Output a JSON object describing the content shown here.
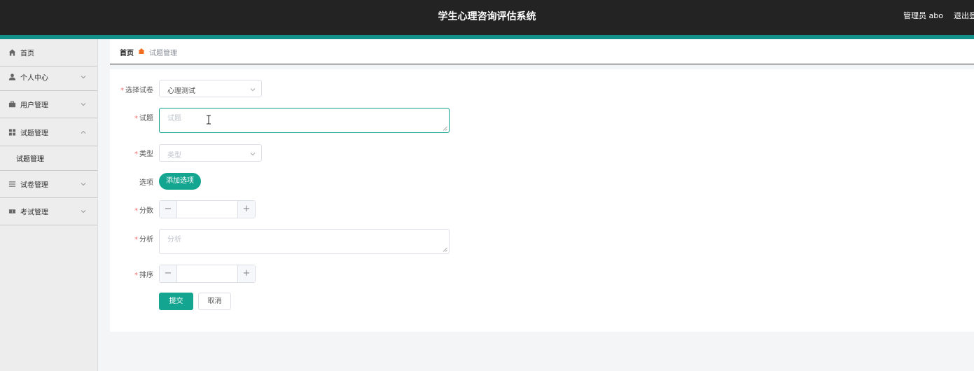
{
  "header": {
    "title": "学生心理咨询评估系统",
    "user": "管理员 abo",
    "logout": "退出登录"
  },
  "colors": {
    "topbar": "#232323",
    "accent": "#13a58f",
    "stripe": "#12918a",
    "required": "#f56c6c",
    "breadcrumb_icon": "#f26c21"
  },
  "sidebar": {
    "items": [
      {
        "label": "首页",
        "icon": "home-icon"
      },
      {
        "label": "个人中心",
        "icon": "user-icon",
        "expandable": true
      },
      {
        "label": "用户管理",
        "icon": "briefcase-icon",
        "expandable": true
      },
      {
        "label": "试题管理",
        "icon": "grid-icon",
        "expandable": true,
        "expanded": true,
        "children": [
          {
            "label": "试题管理"
          }
        ]
      },
      {
        "label": "试卷管理",
        "icon": "list-icon",
        "expandable": true
      },
      {
        "label": "考试管理",
        "icon": "ticket-icon",
        "expandable": true
      }
    ]
  },
  "breadcrumb": {
    "home": "首页",
    "current": "试题管理",
    "separator_icon": "home-marker-icon"
  },
  "form": {
    "paper": {
      "label": "选择试卷",
      "value": "心理测试",
      "required": true
    },
    "question": {
      "label": "试题",
      "placeholder": "试题",
      "required": true
    },
    "type": {
      "label": "类型",
      "placeholder": "类型",
      "required": true
    },
    "options": {
      "label": "选项",
      "add_button": "添加选项"
    },
    "score": {
      "label": "分数",
      "value": "",
      "required": true
    },
    "analysis": {
      "label": "分析",
      "placeholder": "分析",
      "required": true
    },
    "order": {
      "label": "排序",
      "value": "",
      "required": true
    },
    "submit": "提交",
    "cancel": "取消"
  }
}
